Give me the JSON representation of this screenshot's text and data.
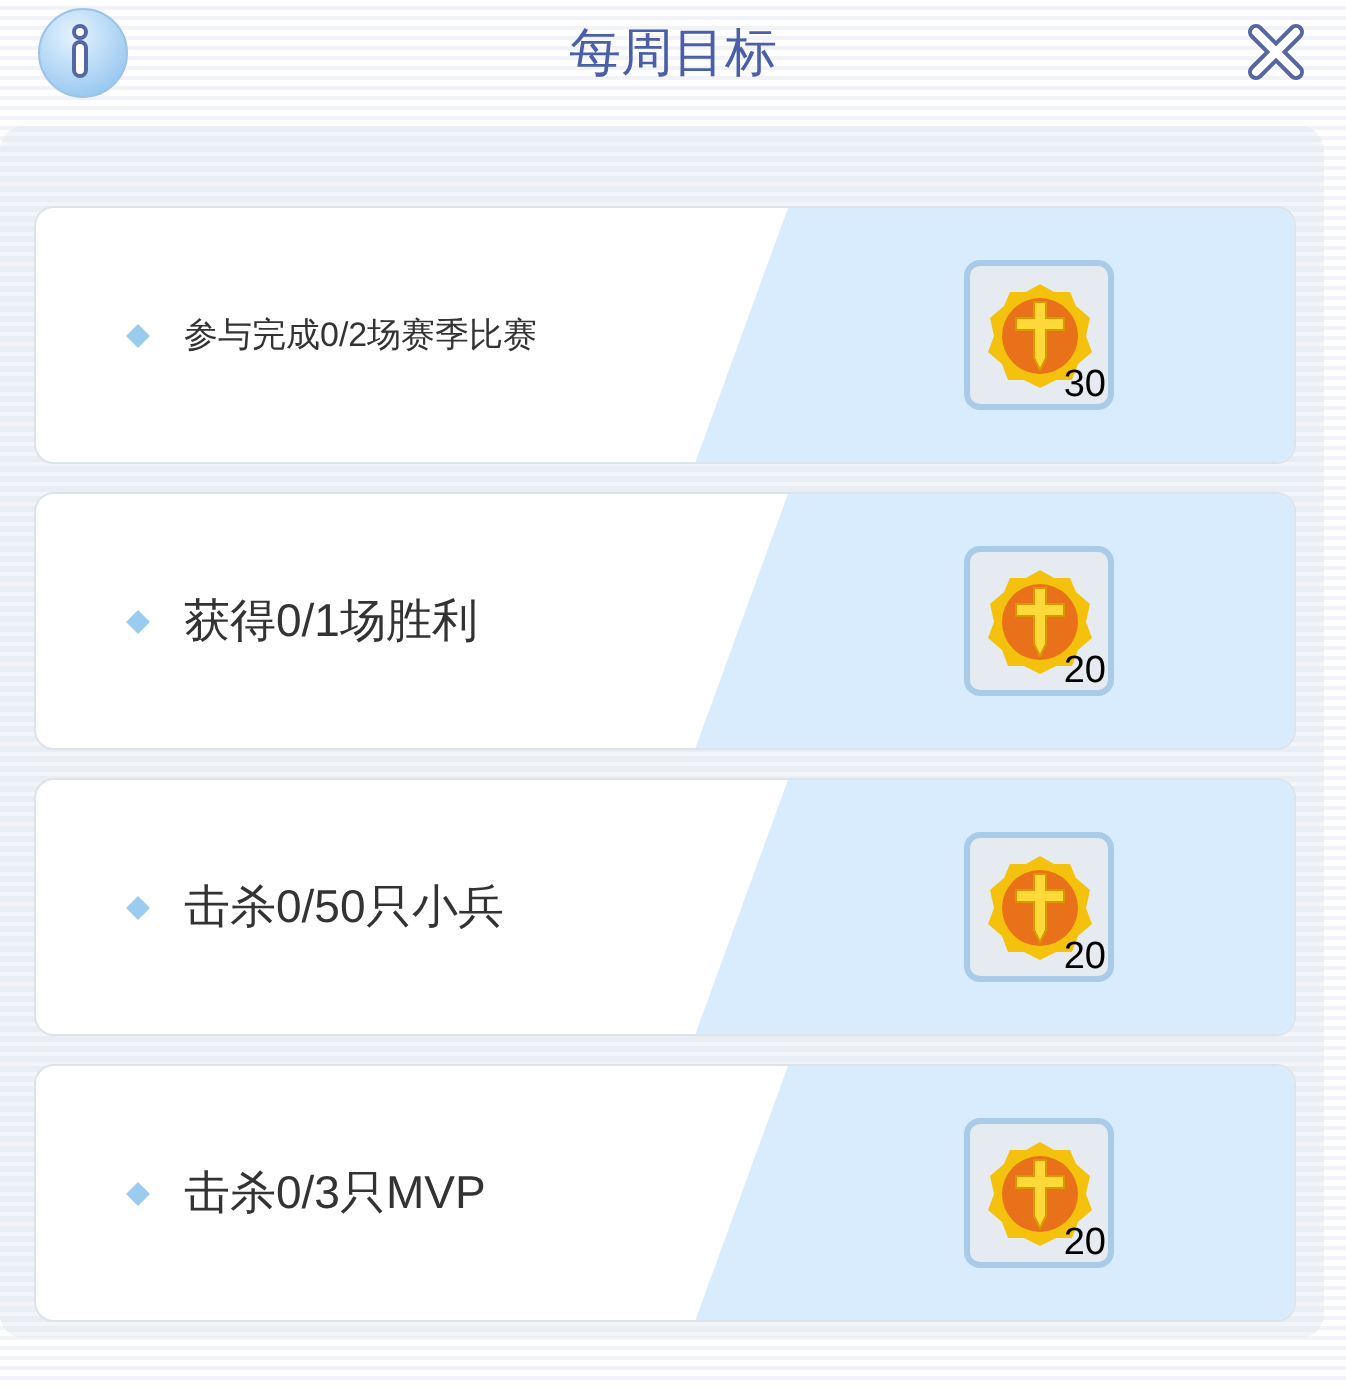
{
  "window": {
    "title": "每周目标"
  },
  "goals": [
    {
      "text": "参与完成0/2场赛季比赛",
      "reward_count": "30"
    },
    {
      "text": "获得0/1场胜利",
      "reward_count": "20"
    },
    {
      "text": "击杀0/50只小兵",
      "reward_count": "20"
    },
    {
      "text": "击杀0/3只MVP",
      "reward_count": "20"
    }
  ]
}
